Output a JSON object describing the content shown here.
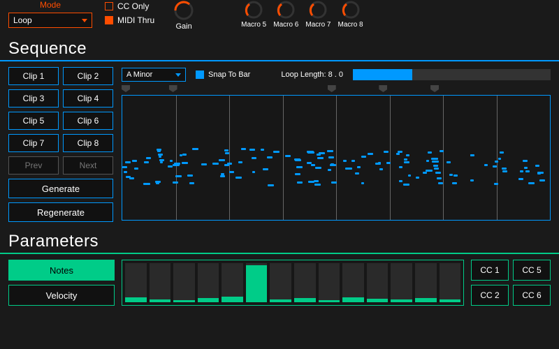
{
  "mode": {
    "label": "Mode",
    "value": "Loop"
  },
  "checks": {
    "cc_only": "CC Only",
    "midi_thru": "MIDI Thru"
  },
  "gain_label": "Gain",
  "macros": [
    "Macro 5",
    "Macro 6",
    "Macro 7",
    "Macro 8"
  ],
  "sequence": {
    "title": "Sequence",
    "clips": [
      "Clip 1",
      "Clip 2",
      "Clip 3",
      "Clip 4",
      "Clip 5",
      "Clip 6",
      "Clip 7",
      "Clip 8"
    ],
    "prev": "Prev",
    "next": "Next",
    "generate": "Generate",
    "regenerate": "Regenerate",
    "scale": "A Minor",
    "snap": "Snap To Bar",
    "loop_label": "Loop Length: 8 . 0",
    "loop_fill_pct": 30,
    "markers_pct": [
      0,
      11,
      48,
      60,
      72
    ]
  },
  "parameters": {
    "title": "Parameters",
    "btns": [
      "Notes",
      "Velocity"
    ],
    "active": 0,
    "bars": [
      12,
      8,
      6,
      10,
      14,
      95,
      8,
      10,
      6,
      12,
      9,
      7,
      11,
      8
    ],
    "cc": [
      "CC 1",
      "CC 5",
      "CC 2",
      "CC 6"
    ]
  }
}
